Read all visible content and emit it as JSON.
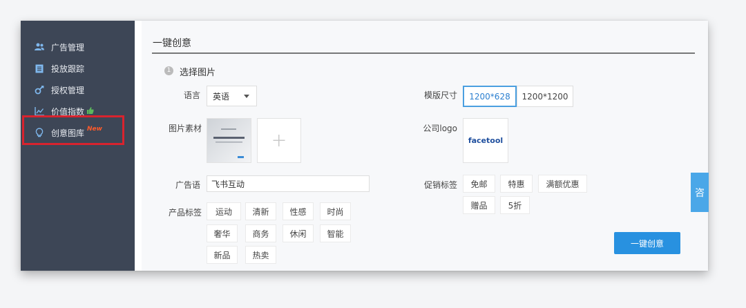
{
  "sidebar": {
    "items": [
      {
        "label": "广告管理",
        "icon": "users-icon"
      },
      {
        "label": "投放跟踪",
        "icon": "document-icon"
      },
      {
        "label": "授权管理",
        "icon": "key-icon"
      },
      {
        "label": "价值指数",
        "icon": "trend-chart-icon",
        "suffix_icon": "thumbs-up-icon"
      },
      {
        "label": "创意图库",
        "icon": "lightbulb-icon",
        "badge": "New"
      }
    ],
    "highlight_color": "#d9232e"
  },
  "main": {
    "title": "一键创意",
    "step": {
      "number": "1",
      "label": "选择图片"
    },
    "language": {
      "label": "语言",
      "value": "英语"
    },
    "template_size": {
      "label": "模版尺寸",
      "options": [
        "1200*628",
        "1200*1200"
      ],
      "selected": "1200*628"
    },
    "image_material": {
      "label": "图片素材",
      "add_icon": "plus-icon"
    },
    "company_logo": {
      "label": "公司logo",
      "logo_text": "facetool"
    },
    "ad_slogan": {
      "label": "广告语",
      "value": "飞书互动"
    },
    "promo_tags": {
      "label": "促销标签",
      "tags": [
        "免邮",
        "特惠",
        "满额优惠",
        "赠品",
        "5折"
      ]
    },
    "product_tags": {
      "label": "产品标签",
      "tags": [
        "运动",
        "清新",
        "性感",
        "时尚",
        "奢华",
        "商务",
        "休闲",
        "智能",
        "新品",
        "热卖"
      ]
    },
    "submit_label": "一键创意"
  },
  "floating_tab": {
    "label": "咨"
  },
  "colors": {
    "accent": "#2891e0",
    "sidebar_bg": "#3d4656",
    "badge": "#ff5a2a"
  }
}
